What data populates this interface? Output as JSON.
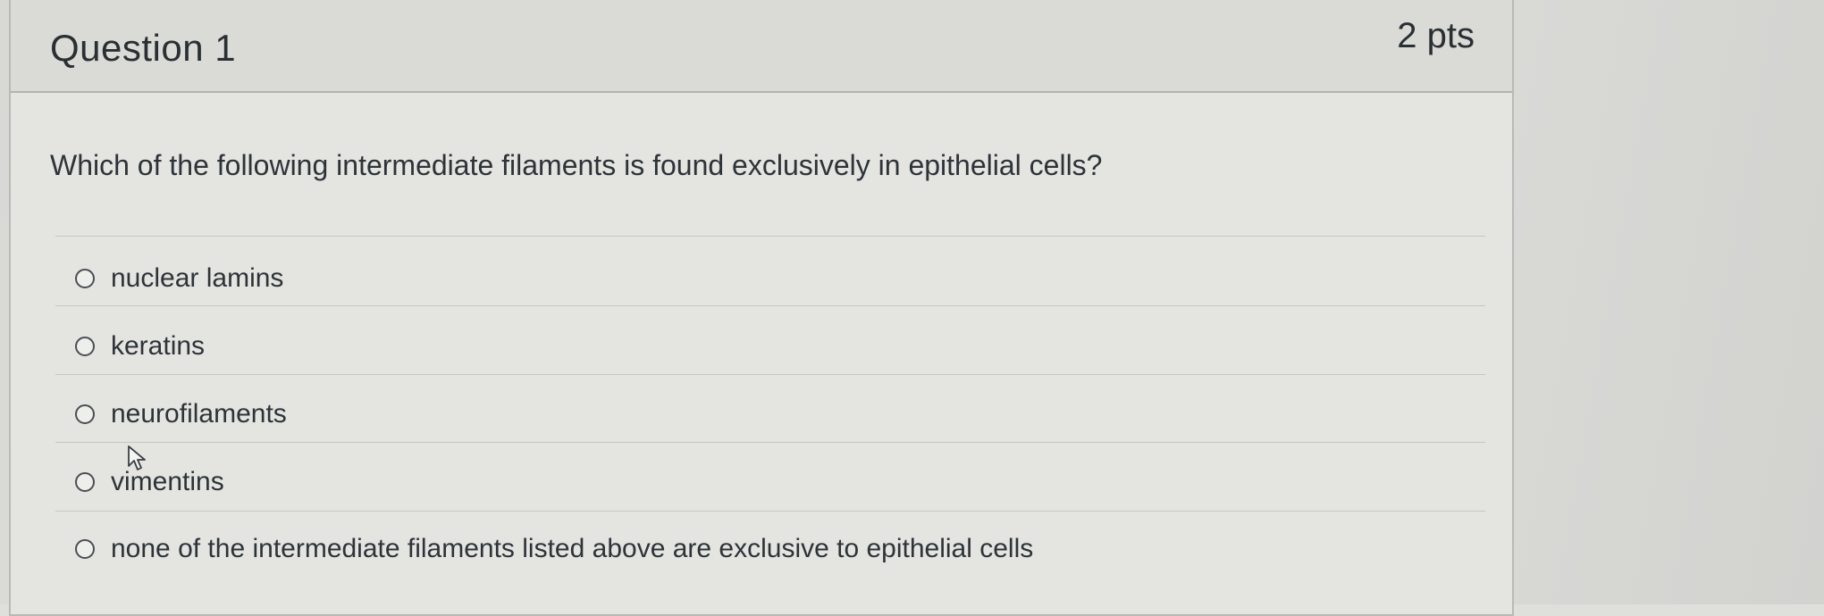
{
  "question": {
    "title": "Question 1",
    "points": "2 pts",
    "text": "Which of the following intermediate filaments is found exclusively in epithelial cells?"
  },
  "answers": [
    {
      "label": "nuclear lamins"
    },
    {
      "label": "keratins"
    },
    {
      "label": "neurofilaments"
    },
    {
      "label": "vimentins"
    },
    {
      "label": "none of the intermediate filaments listed above are exclusive to epithelial cells"
    }
  ],
  "icons": {
    "radio": "radio-unselected-icon",
    "cursor": "mouse-pointer-icon"
  }
}
